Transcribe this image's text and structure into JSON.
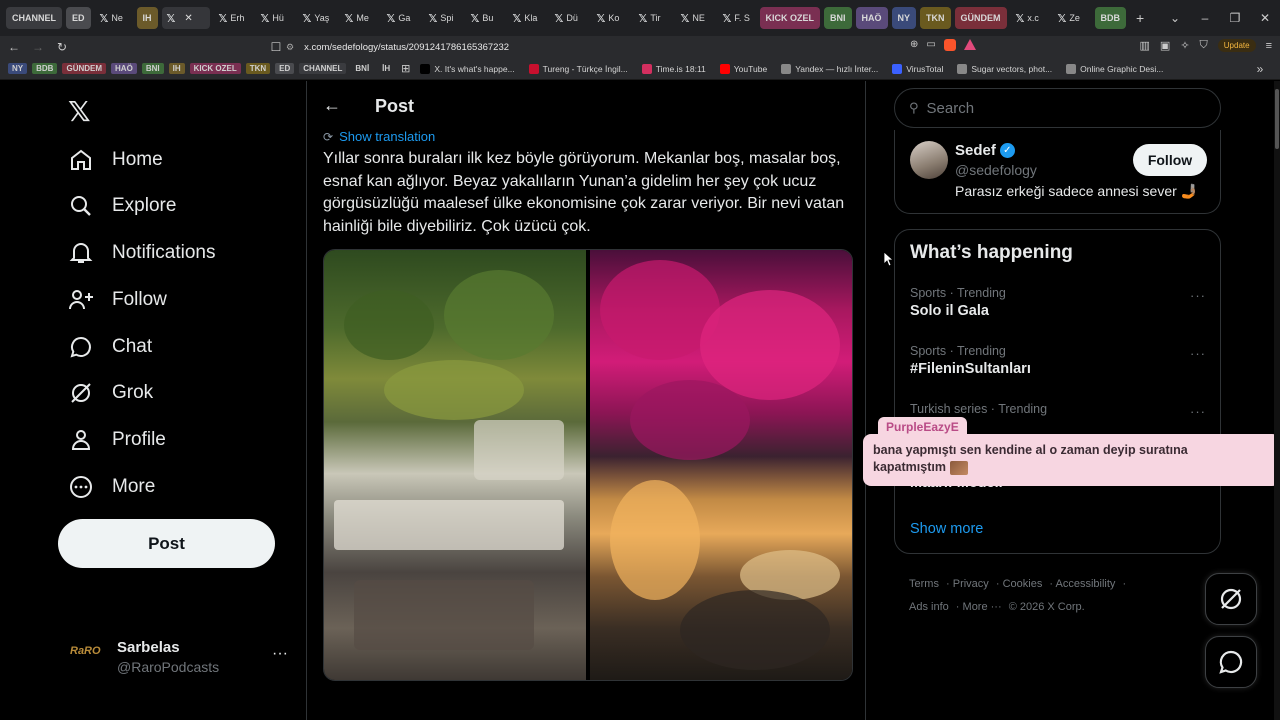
{
  "browser": {
    "tabs": [
      {
        "label": "CHANNEL",
        "color": "#3a3b3f"
      },
      {
        "label": "ED",
        "color": "#4a4b4f"
      },
      {
        "label": "Ne",
        "color": ""
      },
      {
        "label": "IH",
        "color": "#6b5a2a"
      },
      {
        "label": "",
        "color": "",
        "active": true
      },
      {
        "label": "Erh",
        "color": ""
      },
      {
        "label": "Hü",
        "color": ""
      },
      {
        "label": "Yaş",
        "color": ""
      },
      {
        "label": "Me",
        "color": ""
      },
      {
        "label": "Ga",
        "color": ""
      },
      {
        "label": "Spi",
        "color": ""
      },
      {
        "label": "Bu",
        "color": ""
      },
      {
        "label": "Kla",
        "color": ""
      },
      {
        "label": "Dü",
        "color": ""
      },
      {
        "label": "Ko",
        "color": ""
      },
      {
        "label": "Tir",
        "color": ""
      },
      {
        "label": "NE",
        "color": ""
      },
      {
        "label": "F. S",
        "color": ""
      },
      {
        "label": "KICK OZEL",
        "color": "#7a2f52"
      },
      {
        "label": "BNI",
        "color": "#3d6a3a"
      },
      {
        "label": "HAÖ",
        "color": "#5a4a7a"
      },
      {
        "label": "NY",
        "color": "#3a4a7a"
      },
      {
        "label": "TKN",
        "color": "#6a5a1f"
      },
      {
        "label": "GÜNDEM",
        "color": "#7a2f3a"
      },
      {
        "label": "x.c",
        "color": ""
      },
      {
        "label": "Ze",
        "color": ""
      },
      {
        "label": "BDB",
        "color": "#3d6a3a"
      }
    ],
    "url": "x.com/sedefology/status/2091241786165367232",
    "update_label": "Update",
    "bookmark_tags": [
      {
        "label": "NY",
        "color": "#3a4a7a"
      },
      {
        "label": "BDB",
        "color": "#3d6a3a"
      },
      {
        "label": "GÜNDEM",
        "color": "#7a2f3a"
      },
      {
        "label": "HAÖ",
        "color": "#5a4a7a"
      },
      {
        "label": "BNI",
        "color": "#3d6a3a"
      },
      {
        "label": "IH",
        "color": "#6b5a2a"
      },
      {
        "label": "KICK OZEL",
        "color": "#7a2f52"
      },
      {
        "label": "TKN",
        "color": "#6a5a1f"
      },
      {
        "label": "ED",
        "color": "#4a4b4f"
      },
      {
        "label": "CHANNEL",
        "color": "#3a3b3f"
      },
      {
        "label": "BNİ",
        "color": ""
      },
      {
        "label": "İH",
        "color": ""
      }
    ],
    "bookmark_links": [
      {
        "label": "X. It's what's happe...",
        "color": "#000000"
      },
      {
        "label": "Tureng - Türkçe İngil...",
        "color": "#c8102e"
      },
      {
        "label": "Time.is 18:11",
        "color": "#d32f5f"
      },
      {
        "label": "YouTube",
        "color": "#ff0000"
      },
      {
        "label": "Yandex — hızlı İnter...",
        "color": "#888888"
      },
      {
        "label": "VirusTotal",
        "color": "#3b61ff"
      },
      {
        "label": "Sugar vectors, phot...",
        "color": "#888888"
      },
      {
        "label": "Online Graphic Desi...",
        "color": "#888888"
      }
    ]
  },
  "nav": {
    "items": [
      {
        "label": "Home",
        "icon": "home-icon"
      },
      {
        "label": "Explore",
        "icon": "search-icon"
      },
      {
        "label": "Notifications",
        "icon": "bell-icon"
      },
      {
        "label": "Follow",
        "icon": "person-plus-icon"
      },
      {
        "label": "Chat",
        "icon": "chat-icon"
      },
      {
        "label": "Grok",
        "icon": "grok-icon"
      },
      {
        "label": "Profile",
        "icon": "person-icon"
      },
      {
        "label": "More",
        "icon": "more-circle-icon"
      }
    ],
    "post_button": "Post",
    "account": {
      "logo_text": "RaRO",
      "name": "Sarbelas",
      "handle": "@RaroPodcasts",
      "dots": "···"
    }
  },
  "post": {
    "title": "Post",
    "show_translation": "Show translation",
    "text": "Yıllar sonra buraları ilk kez böyle görüyorum. Mekanlar boş, masalar boş, esnaf kan ağlıyor. Beyaz yakalıların Yunan’a gidelim her şey çok ucuz görgüsüzlüğü maalesef ülke ekonomisine çok zarar veriyor. Bir nevi vatan hainliği bile diyebiliriz. Çok üzücü çok."
  },
  "sidebar": {
    "search_placeholder": "Search",
    "profile": {
      "name": "Sedef",
      "handle": "@sedefology",
      "bio": "Parasız erkeği sadece annesi sever 🤳🏽",
      "follow_label": "Follow"
    },
    "trends_heading": "What’s happening",
    "trends": [
      {
        "meta": "Sports · Trending",
        "topic": "Solo il Gala"
      },
      {
        "meta": "Sports · Trending",
        "topic": "#FileninSultanları"
      },
      {
        "meta": "Turkish series · Trending",
        "topic": ""
      },
      {
        "meta": "",
        "topic": "Maarif Modeli"
      }
    ],
    "show_more": "Show more",
    "footer": {
      "terms": "Terms",
      "privacy": "Privacy",
      "cookies": "Cookies",
      "accessibility": "Accessibility",
      "ads_info": "Ads info",
      "more": "More ···",
      "copyright": "© 2026 X Corp."
    }
  },
  "overlay": {
    "username": "PurpleEazyE",
    "message": "bana yapmıştı sen kendine al o zaman deyip suratına kapatmıştım"
  },
  "colors": {
    "accent": "#1d9bf0",
    "background": "#000000",
    "overlay_bg": "#f7d6e1"
  }
}
